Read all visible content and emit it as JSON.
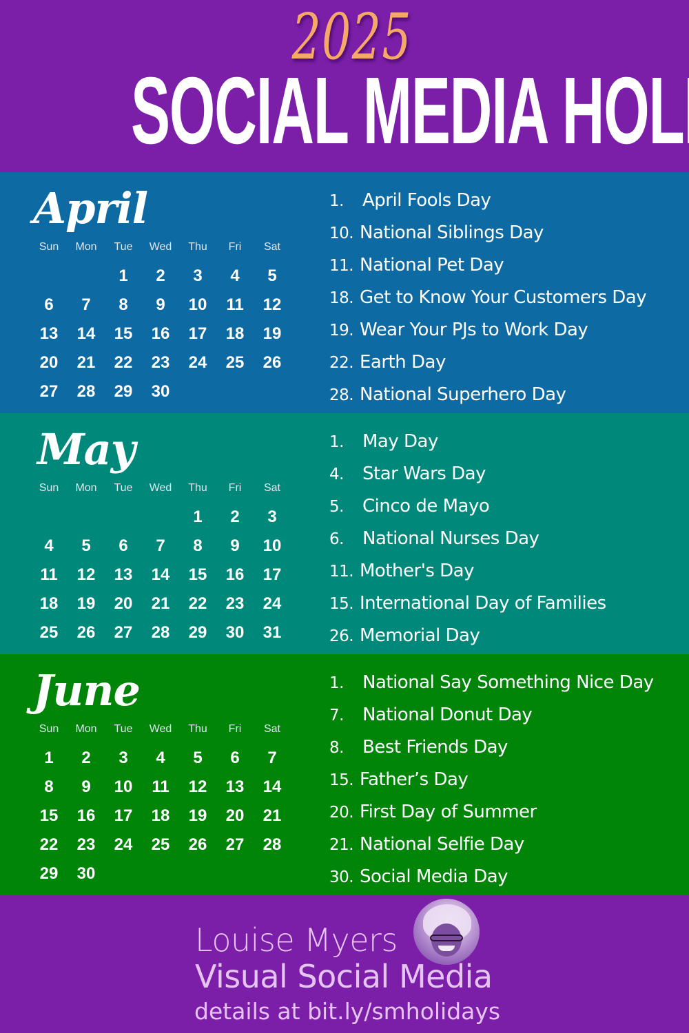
{
  "header": {
    "year": "2025",
    "title": "SOCIAL MEDIA HOLIDAYS"
  },
  "colors": {
    "purple": "#7b1fa8",
    "april": "#0e6aa3",
    "may": "#00897b",
    "june": "#008508",
    "year_accent": "#f6a868",
    "footer_text": "#e6c4f2"
  },
  "weekdays": [
    "Sun",
    "Mon",
    "Tue",
    "Wed",
    "Thu",
    "Fri",
    "Sat"
  ],
  "months": [
    {
      "name": "April",
      "cells": [
        "",
        "",
        "1",
        "2",
        "3",
        "4",
        "5",
        "6",
        "7",
        "8",
        "9",
        "10",
        "11",
        "12",
        "13",
        "14",
        "15",
        "16",
        "17",
        "18",
        "19",
        "20",
        "21",
        "22",
        "23",
        "24",
        "25",
        "26",
        "27",
        "28",
        "29",
        "30",
        "",
        "",
        ""
      ],
      "holidays": [
        {
          "day": "1.",
          "name": "April Fools Day"
        },
        {
          "day": "10.",
          "name": "National Siblings Day"
        },
        {
          "day": "11.",
          "name": "National Pet Day"
        },
        {
          "day": "18.",
          "name": "Get to Know Your Customers Day"
        },
        {
          "day": "19.",
          "name": "Wear Your PJs to Work Day"
        },
        {
          "day": "22.",
          "name": "Earth Day"
        },
        {
          "day": "28.",
          "name": "National Superhero Day"
        }
      ]
    },
    {
      "name": "May",
      "cells": [
        "",
        "",
        "",
        "",
        "1",
        "2",
        "3",
        "4",
        "5",
        "6",
        "7",
        "8",
        "9",
        "10",
        "11",
        "12",
        "13",
        "14",
        "15",
        "16",
        "17",
        "18",
        "19",
        "20",
        "21",
        "22",
        "23",
        "24",
        "25",
        "26",
        "27",
        "28",
        "29",
        "30",
        "31"
      ],
      "holidays": [
        {
          "day": "1.",
          "name": "May Day"
        },
        {
          "day": "4.",
          "name": "Star Wars Day"
        },
        {
          "day": "5.",
          "name": "Cinco de Mayo"
        },
        {
          "day": "6.",
          "name": "National Nurses Day"
        },
        {
          "day": "11.",
          "name": "Mother's Day"
        },
        {
          "day": "15.",
          "name": "International Day of Families"
        },
        {
          "day": "26.",
          "name": "Memorial Day"
        }
      ]
    },
    {
      "name": "June",
      "cells": [
        "1",
        "2",
        "3",
        "4",
        "5",
        "6",
        "7",
        "8",
        "9",
        "10",
        "11",
        "12",
        "13",
        "14",
        "15",
        "16",
        "17",
        "18",
        "19",
        "20",
        "21",
        "22",
        "23",
        "24",
        "25",
        "26",
        "27",
        "28",
        "29",
        "30",
        "",
        "",
        "",
        "",
        ""
      ],
      "holidays": [
        {
          "day": "1.",
          "name": "National Say Something Nice Day"
        },
        {
          "day": "7.",
          "name": "National Donut Day"
        },
        {
          "day": "8.",
          "name": "Best Friends Day"
        },
        {
          "day": "15.",
          "name": "Father’s Day"
        },
        {
          "day": "20.",
          "name": "First Day of Summer"
        },
        {
          "day": "21.",
          "name": "National Selfie Day"
        },
        {
          "day": "30.",
          "name": "Social Media Day"
        }
      ]
    }
  ],
  "footer": {
    "author": "Louise Myers",
    "brand": "Visual Social Media",
    "details": "details at bit.ly/smholidays",
    "avatar_icon": "author-photo"
  }
}
